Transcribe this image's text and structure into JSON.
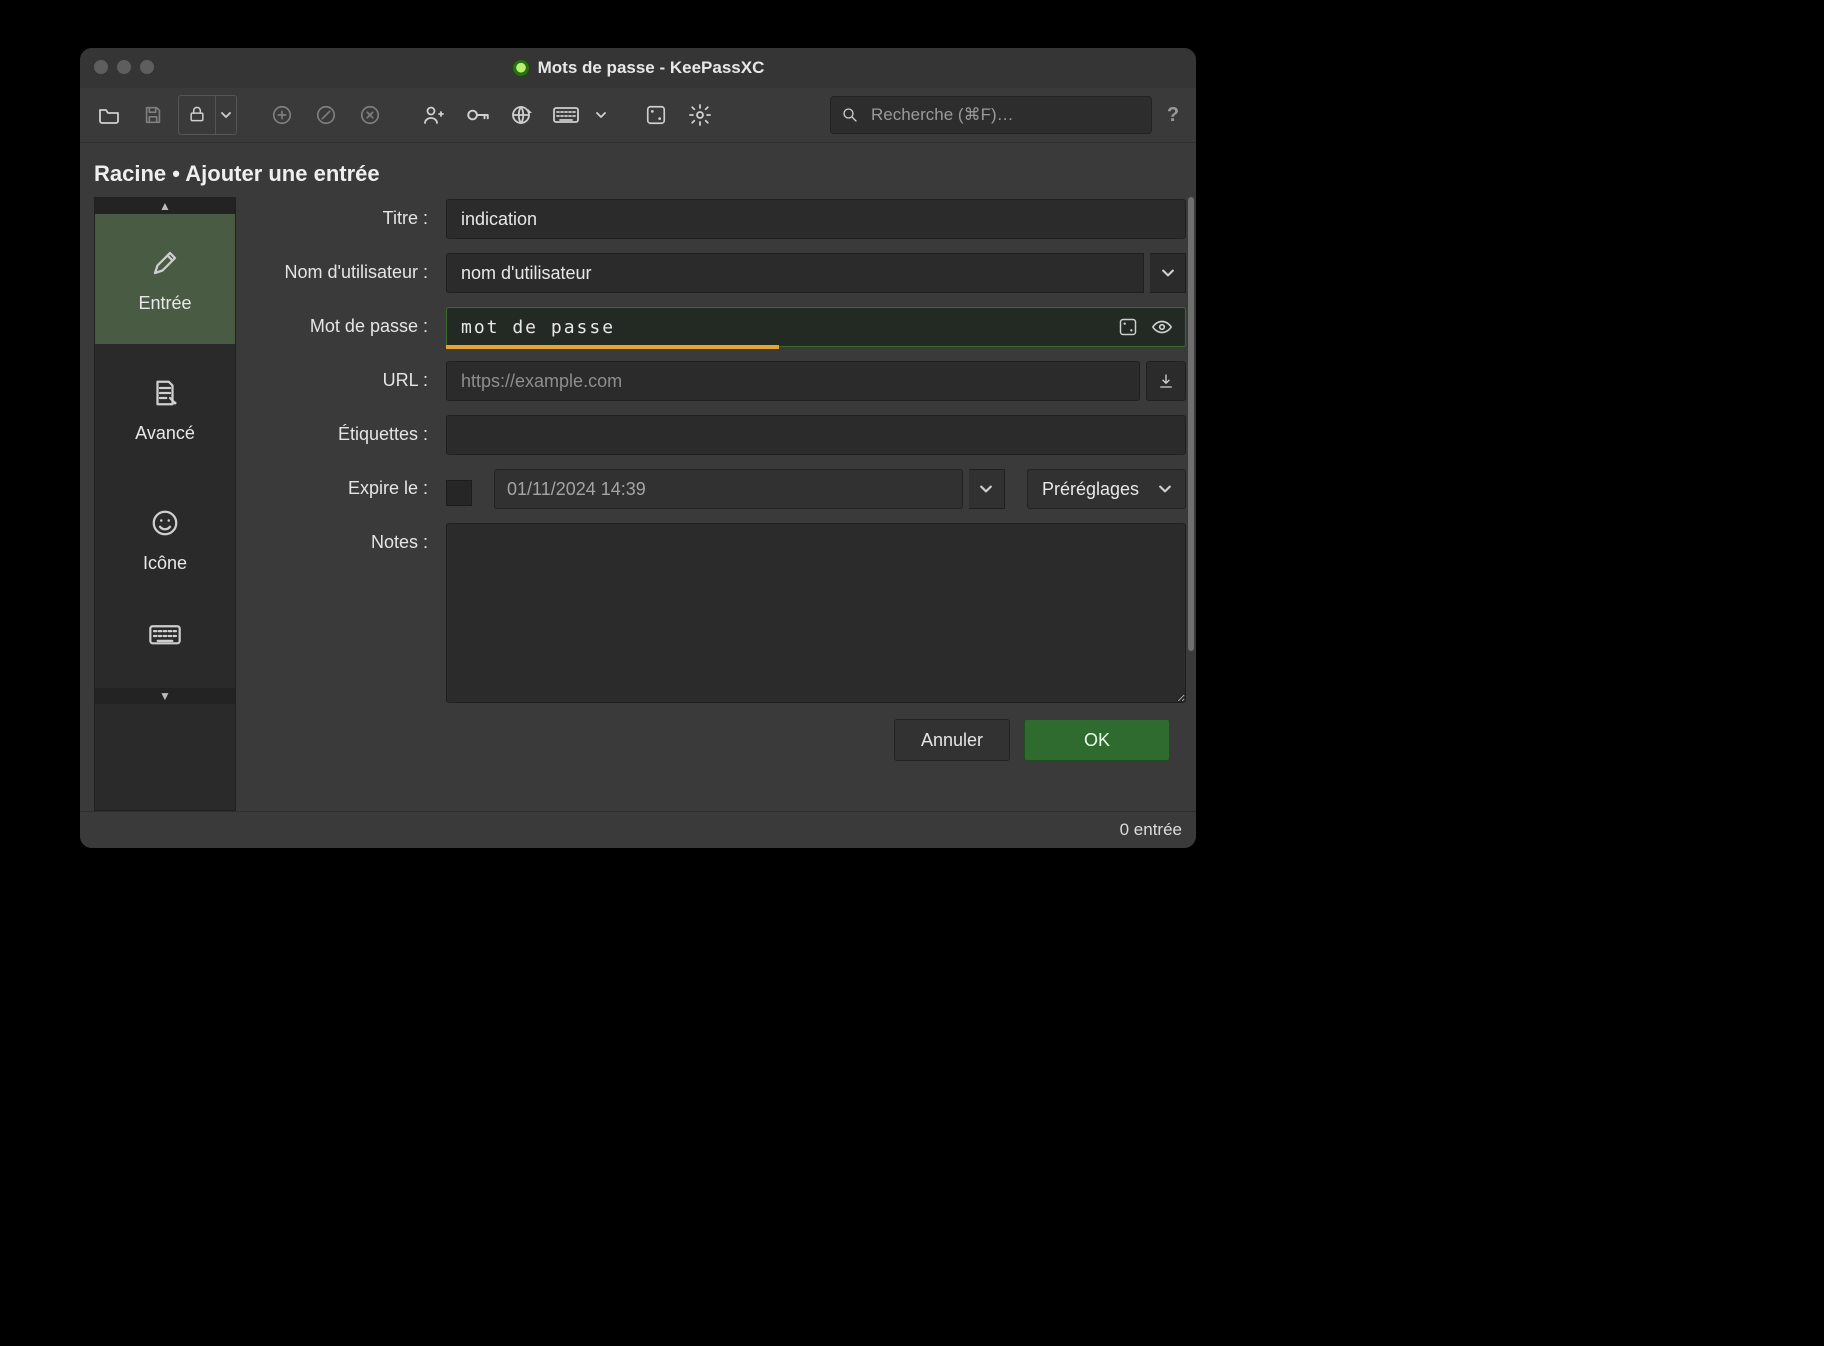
{
  "window": {
    "title": "Mots de passe - KeePassXC"
  },
  "toolbar": {
    "search_placeholder": "Recherche (⌘F)…"
  },
  "breadcrumb": "Racine • Ajouter une entrée",
  "sidetabs": {
    "entry": "Entrée",
    "advanced": "Avancé",
    "icon": "Icône"
  },
  "form": {
    "title_label": "Titre :",
    "title_value": "indication",
    "username_label": "Nom d'utilisateur :",
    "username_value": "nom d'utilisateur",
    "password_label": "Mot de passe :",
    "password_value": "mot de passe",
    "url_label": "URL :",
    "url_placeholder": "https://example.com",
    "tags_label": "Étiquettes :",
    "expires_label": "Expire le :",
    "expires_value": "01/11/2024 14:39",
    "presets_label": "Préréglages",
    "notes_label": "Notes :"
  },
  "buttons": {
    "cancel": "Annuler",
    "ok": "OK"
  },
  "status": "0 entrée"
}
